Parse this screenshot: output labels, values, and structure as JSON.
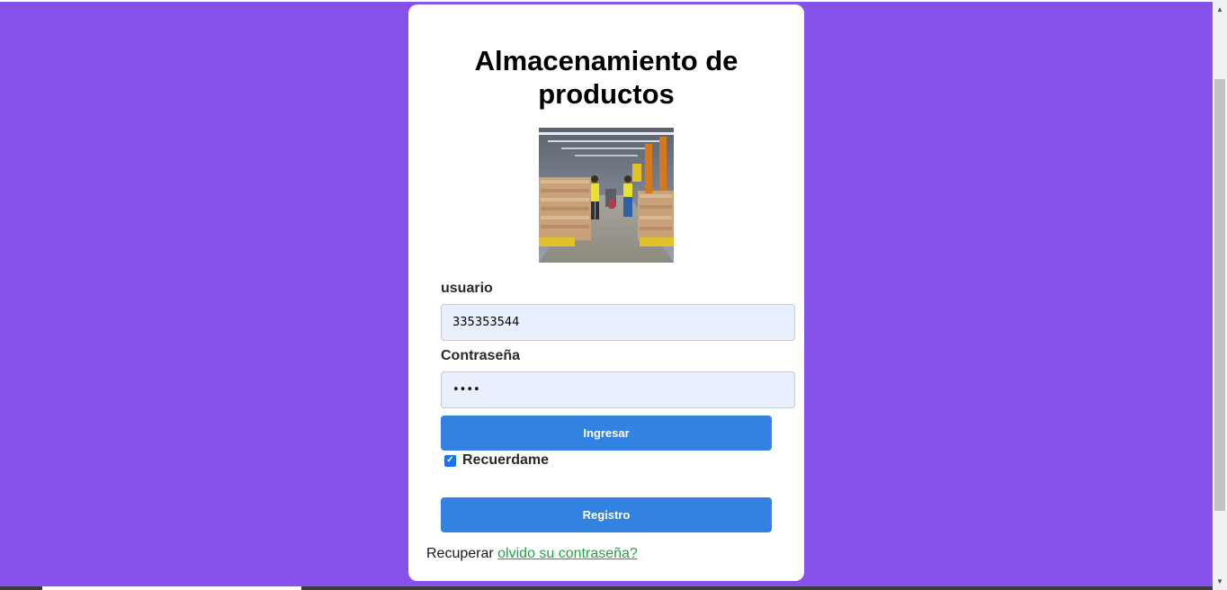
{
  "page": {
    "title": "Almacenamiento de productos",
    "background_color": "#8752ec",
    "accent_color": "#3282e2",
    "link_color": "#27a048"
  },
  "form": {
    "username_label": "usuario",
    "username_value": "335353544",
    "password_label": "Contraseña",
    "password_value": "••••",
    "login_button": "Ingresar",
    "remember_label": "Recuerdame",
    "remember_checked": true,
    "register_button": "Registro",
    "recover_prefix": "Recuperar",
    "recover_link": "olvido su contraseña?"
  },
  "image": {
    "subject": "warehouse-photo"
  }
}
